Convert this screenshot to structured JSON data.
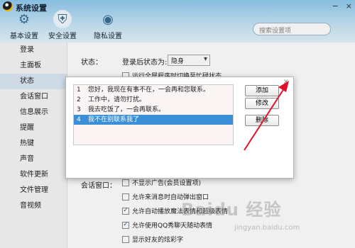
{
  "window": {
    "title": "系统设置",
    "controls": [
      "−",
      "×"
    ]
  },
  "tabs": [
    {
      "label": "基本设置",
      "icon": "gear-icon",
      "glyph": "⚙"
    },
    {
      "label": "安全设置",
      "icon": "shield-icon",
      "glyph": "⛨"
    },
    {
      "label": "隐私设置",
      "icon": "privacy-icon",
      "glyph": "◉"
    }
  ],
  "search": {
    "placeholder": "搜索设置项"
  },
  "sidebar": {
    "items": [
      {
        "label": "登录"
      },
      {
        "label": "主面板"
      },
      {
        "label": "状态",
        "active": true
      },
      {
        "label": "会话窗口"
      },
      {
        "label": "信息展示"
      },
      {
        "label": "提醒"
      },
      {
        "label": "热键"
      },
      {
        "label": "声音"
      },
      {
        "label": "软件更新"
      },
      {
        "label": "文件管理"
      },
      {
        "label": "音视频"
      }
    ]
  },
  "status": {
    "section_label": "状态：",
    "after_login_label": "登录后状态为:",
    "after_login_value": "隐身",
    "fullscreen_option": "运行全屏程序时切换至忙碌状态"
  },
  "session": {
    "section_label": "会话窗口：",
    "options": [
      {
        "label": "不显示广告(会员设置项)",
        "checked": false
      },
      {
        "label": "允许来消息时自动弹出窗口",
        "checked": false
      },
      {
        "label": "允许自动播放魔法表情和超级表情",
        "checked": true
      },
      {
        "label": "允许使用QQ秀聊天随动表情",
        "checked": true
      },
      {
        "label": "显示好友的炫彩字",
        "checked": false
      }
    ]
  },
  "dialog": {
    "close_glyph": "×",
    "replies": [
      {
        "num": "1",
        "text": "您好，我现在有事不在，一会再和您联系。"
      },
      {
        "num": "2",
        "text": "工作中，请勿打扰。"
      },
      {
        "num": "3",
        "text": "我去吃饭了，一会再联系。"
      },
      {
        "num": "4",
        "text": "我不在别联系我了",
        "selected": true
      }
    ],
    "add_label": "添加",
    "edit_label": "修改",
    "delete_label": "删除"
  },
  "watermark": {
    "brand": "Baidu 经验",
    "url": "jingyan.baidu.com"
  },
  "colors": {
    "header": "#8fc9ee",
    "selection": "#3b8fd6",
    "arrow": "#e0102a"
  }
}
